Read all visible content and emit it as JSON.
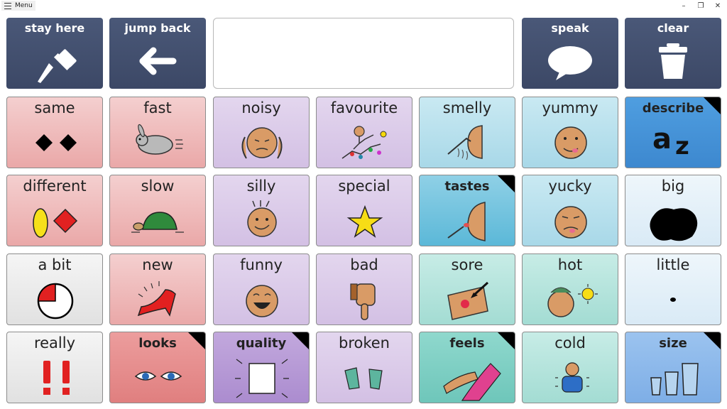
{
  "window": {
    "menu_label": "Menu",
    "controls": [
      "–",
      "❐",
      "✕"
    ]
  },
  "toolbar": {
    "stay_here": "stay here",
    "jump_back": "jump back",
    "speak": "speak",
    "clear": "clear"
  },
  "message": {
    "text": ""
  },
  "grid": {
    "r1": [
      "same",
      "fast",
      "noisy",
      "favourite",
      "smelly",
      "yummy",
      "describe"
    ],
    "r2": [
      "different",
      "slow",
      "silly",
      "special",
      "tastes",
      "yucky",
      "big"
    ],
    "r3": [
      "a bit",
      "new",
      "funny",
      "bad",
      "sore",
      "hot",
      "little"
    ],
    "r4": [
      "really",
      "looks",
      "quality",
      "broken",
      "feels",
      "cold",
      "size"
    ]
  },
  "colors": {
    "toolbar": "#434f6f",
    "pink": "#f0bcbc",
    "lavender": "#dccbe9",
    "sky": "#b8e0ee",
    "aqua": "#b5e4dc",
    "blue": "#4a96dc",
    "grey": "#ececec"
  }
}
